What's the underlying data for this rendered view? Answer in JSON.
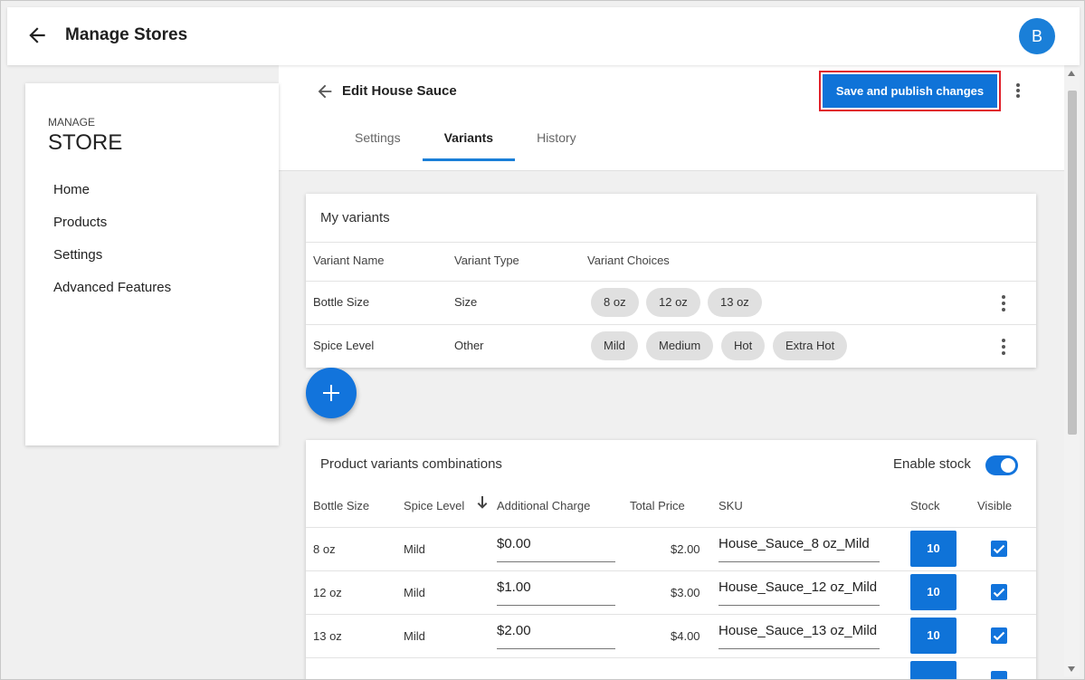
{
  "app": {
    "title": "Manage Stores",
    "avatar_initial": "B"
  },
  "sidebar": {
    "kicker": "MANAGE",
    "name": "STORE",
    "items": [
      {
        "label": "Home"
      },
      {
        "label": "Products"
      },
      {
        "label": "Settings"
      },
      {
        "label": "Advanced Features"
      }
    ]
  },
  "editor": {
    "title": "Edit House Sauce",
    "save_label": "Save and publish changes",
    "tabs": [
      {
        "label": "Settings",
        "active": false
      },
      {
        "label": "Variants",
        "active": true
      },
      {
        "label": "History",
        "active": false
      }
    ]
  },
  "variants": {
    "title": "My variants",
    "headers": [
      "Variant Name",
      "Variant Type",
      "Variant Choices"
    ],
    "rows": [
      {
        "name": "Bottle Size",
        "type": "Size",
        "choices": [
          "8 oz",
          "12 oz",
          "13 oz"
        ]
      },
      {
        "name": "Spice Level",
        "type": "Other",
        "choices": [
          "Mild",
          "Medium",
          "Hot",
          "Extra Hot"
        ]
      }
    ],
    "add_icon": "plus-icon"
  },
  "combinations": {
    "title": "Product variants combinations",
    "enable_stock_label": "Enable stock",
    "enable_stock": true,
    "headers": [
      "Bottle Size",
      "Spice Level",
      "Additional Charge",
      "Total Price",
      "SKU",
      "Stock",
      "Visible"
    ],
    "sort_icon": "arrow-down-icon",
    "rows": [
      {
        "size": "8 oz",
        "spice": "Mild",
        "charge": "$0.00",
        "total": "$2.00",
        "sku": "House_Sauce_8 oz_Mild",
        "stock": "10",
        "visible": true
      },
      {
        "size": "12 oz",
        "spice": "Mild",
        "charge": "$1.00",
        "total": "$3.00",
        "sku": "House_Sauce_12 oz_Mild",
        "stock": "10",
        "visible": true
      },
      {
        "size": "13 oz",
        "spice": "Mild",
        "charge": "$2.00",
        "total": "$4.00",
        "sku": "House_Sauce_13 oz_Mild",
        "stock": "10",
        "visible": true
      }
    ]
  },
  "colors": {
    "accent": "#1274dc",
    "highlight_border": "#e0202a"
  }
}
